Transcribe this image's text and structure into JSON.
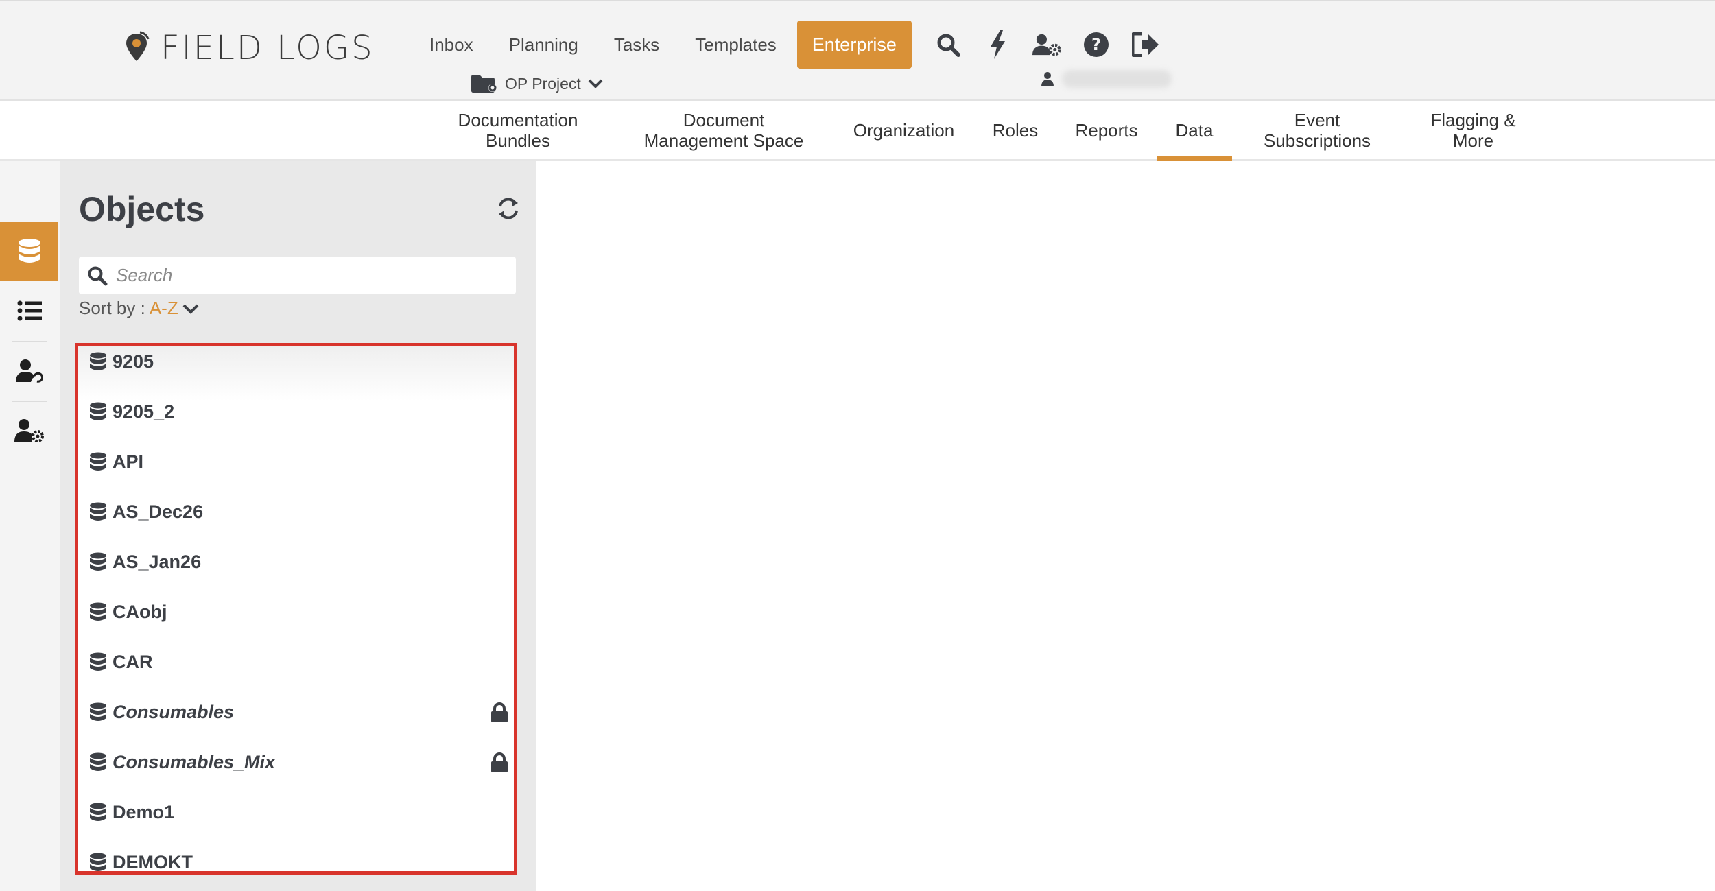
{
  "brand": {
    "name": "FIELD LOGS",
    "accent_color": "#d99137"
  },
  "nav": {
    "links": [
      "Inbox",
      "Planning",
      "Tasks",
      "Templates"
    ],
    "enterprise_label": "Enterprise",
    "icons": [
      "search-icon",
      "bolt-icon",
      "user-settings-icon",
      "help-icon",
      "logout-icon"
    ]
  },
  "project": {
    "label": "OP Project"
  },
  "tabs": [
    {
      "label": "Documentation Bundles"
    },
    {
      "label": "Document Management Space"
    },
    {
      "label": "Organization"
    },
    {
      "label": "Roles"
    },
    {
      "label": "Reports"
    },
    {
      "label": "Data",
      "active": true
    },
    {
      "label": "Event Subscriptions"
    },
    {
      "label": "Flagging & More"
    }
  ],
  "rail": {
    "items": [
      "database-icon",
      "list-icon",
      "user-sync-icon",
      "user-gear-icon"
    ],
    "active_index": 0
  },
  "objects": {
    "title": "Objects",
    "search_placeholder": "Search",
    "sort_label": "Sort by :",
    "sort_value": "A-Z",
    "items": [
      {
        "label": "9205",
        "locked": false
      },
      {
        "label": "9205_2",
        "locked": false
      },
      {
        "label": "API",
        "locked": false
      },
      {
        "label": "AS_Dec26",
        "locked": false
      },
      {
        "label": "AS_Jan26",
        "locked": false
      },
      {
        "label": "CAobj",
        "locked": false
      },
      {
        "label": "CAR",
        "locked": false
      },
      {
        "label": "Consumables",
        "locked": true
      },
      {
        "label": "Consumables_Mix",
        "locked": true
      },
      {
        "label": "Demo1",
        "locked": false
      },
      {
        "label": "DEMOKT",
        "locked": false
      }
    ]
  }
}
